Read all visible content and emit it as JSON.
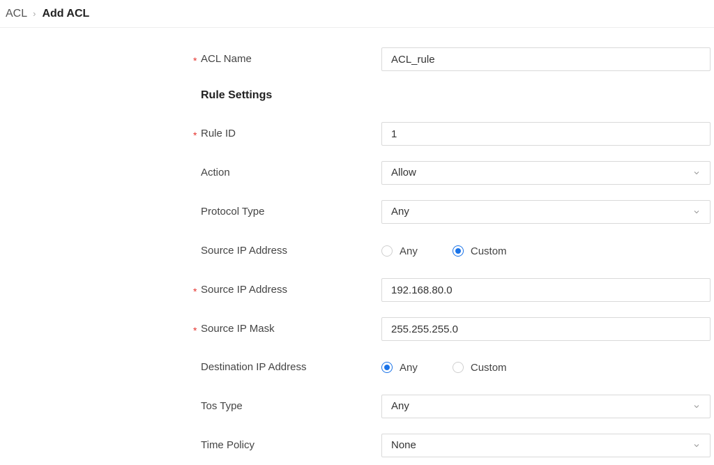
{
  "breadcrumb": {
    "parent": "ACL",
    "current": "Add ACL"
  },
  "form": {
    "acl_name": {
      "label": "ACL Name",
      "value": "ACL_rule",
      "required": true
    },
    "section_title": "Rule Settings",
    "rule_id": {
      "label": "Rule ID",
      "value": "1",
      "required": true
    },
    "action": {
      "label": "Action",
      "value": "Allow"
    },
    "protocol_type": {
      "label": "Protocol Type",
      "value": "Any"
    },
    "source_ip_mode": {
      "label": "Source IP Address",
      "options": [
        "Any",
        "Custom"
      ],
      "selected": "Custom"
    },
    "source_ip_address": {
      "label": "Source IP Address",
      "value": "192.168.80.0",
      "required": true
    },
    "source_ip_mask": {
      "label": "Source IP Mask",
      "value": "255.255.255.0",
      "required": true
    },
    "destination_ip_mode": {
      "label": "Destination IP Address",
      "options": [
        "Any",
        "Custom"
      ],
      "selected": "Any"
    },
    "tos_type": {
      "label": "Tos Type",
      "value": "Any"
    },
    "time_policy": {
      "label": "Time Policy",
      "value": "None"
    },
    "required_marker": "*"
  },
  "colors": {
    "accent": "#1a73e8",
    "required": "#e5322d",
    "border": "#d9d9d9"
  },
  "icons": {
    "select_arrow": "chevron-down-icon",
    "breadcrumb_separator": "chevron-right-icon"
  }
}
